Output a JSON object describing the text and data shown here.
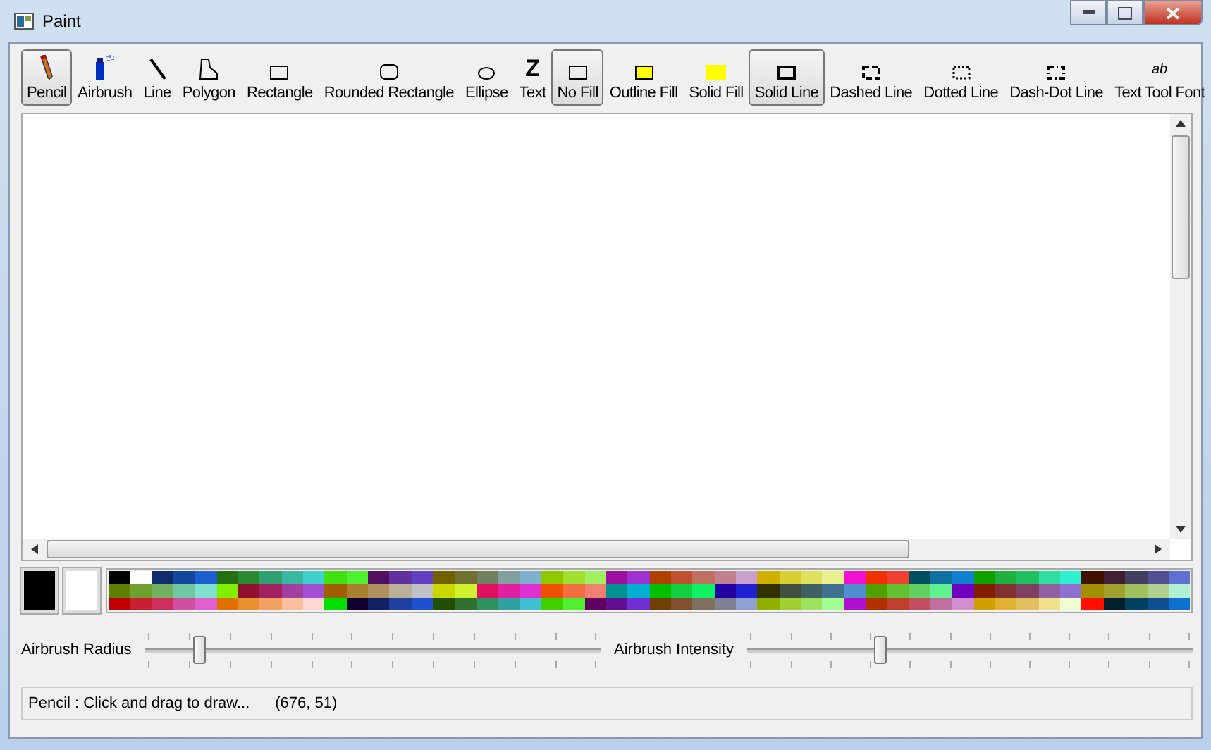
{
  "window": {
    "title": "Paint"
  },
  "tools": [
    {
      "kind": "pencil",
      "label": "Pencil",
      "selected": true
    },
    {
      "kind": "airbrush",
      "label": "Airbrush",
      "selected": false
    },
    {
      "kind": "line",
      "label": "Line",
      "selected": false
    },
    {
      "kind": "polygon",
      "label": "Polygon",
      "selected": false
    },
    {
      "kind": "rectangle",
      "label": "Rectangle",
      "selected": false
    },
    {
      "kind": "rounded",
      "label": "Rounded Rectangle",
      "selected": false
    },
    {
      "kind": "ellipse",
      "label": "Ellipse",
      "selected": false
    },
    {
      "kind": "text",
      "label": "Text",
      "selected": false,
      "glyph": "Z"
    }
  ],
  "fills": [
    {
      "kind": "none",
      "label": "No Fill",
      "selected": true
    },
    {
      "kind": "outline",
      "label": "Outline Fill",
      "selected": false
    },
    {
      "kind": "solid",
      "label": "Solid Fill",
      "selected": false
    }
  ],
  "line_styles": [
    {
      "kind": "solid",
      "label": "Solid Line",
      "selected": true
    },
    {
      "kind": "dashed",
      "label": "Dashed Line",
      "selected": false
    },
    {
      "kind": "dotted",
      "label": "Dotted Line",
      "selected": false
    },
    {
      "kind": "dashdot",
      "label": "Dash-Dot Line",
      "selected": false
    }
  ],
  "font_button": {
    "label": "Text Tool Font",
    "glyph": "ab"
  },
  "current_colors": [
    {
      "color": "#000000"
    },
    {
      "color": "#ffffff"
    }
  ],
  "palette_rows": [
    {
      "swatches": [
        {
          "color": "#000000"
        },
        {
          "color": "#ffffff"
        },
        {
          "color": "#0f2d6a"
        },
        {
          "color": "#1448a0"
        },
        {
          "color": "#1e5fd0"
        },
        {
          "color": "#237010"
        },
        {
          "color": "#2a8a30"
        },
        {
          "color": "#30a070"
        },
        {
          "color": "#38b8a0"
        },
        {
          "color": "#40d0d0"
        },
        {
          "color": "#40e010"
        },
        {
          "color": "#50f030"
        },
        {
          "color": "#501060"
        },
        {
          "color": "#6030a0"
        },
        {
          "color": "#6040c0"
        },
        {
          "color": "#706000"
        },
        {
          "color": "#707030"
        },
        {
          "color": "#708060"
        },
        {
          "color": "#80a0a0"
        },
        {
          "color": "#80b0d0"
        },
        {
          "color": "#90c800"
        },
        {
          "color": "#a0e030"
        },
        {
          "color": "#a0f060"
        },
        {
          "color": "#a010a0"
        },
        {
          "color": "#a030d0"
        },
        {
          "color": "#b04000"
        },
        {
          "color": "#c05030"
        },
        {
          "color": "#c07060"
        },
        {
          "color": "#c08090"
        },
        {
          "color": "#c8a0d0"
        },
        {
          "color": "#d0b000"
        },
        {
          "color": "#d8d030"
        },
        {
          "color": "#e0e060"
        },
        {
          "color": "#e8f090"
        },
        {
          "color": "#f010d0"
        },
        {
          "color": "#f03000"
        },
        {
          "color": "#f04030"
        },
        {
          "color": "#005060"
        },
        {
          "color": "#1070a0"
        },
        {
          "color": "#1080d0"
        },
        {
          "color": "#10a000"
        },
        {
          "color": "#20b040"
        },
        {
          "color": "#20c060"
        },
        {
          "color": "#30e0a0"
        },
        {
          "color": "#30f0d0"
        },
        {
          "color": "#401000"
        },
        {
          "color": "#402030"
        },
        {
          "color": "#404060"
        },
        {
          "color": "#505090"
        },
        {
          "color": "#6070d0"
        }
      ]
    },
    {
      "swatches": [
        {
          "color": "#608000"
        },
        {
          "color": "#70a030"
        },
        {
          "color": "#70b060"
        },
        {
          "color": "#70c8a0"
        },
        {
          "color": "#80e0d0"
        },
        {
          "color": "#80f000"
        },
        {
          "color": "#901030"
        },
        {
          "color": "#a02060"
        },
        {
          "color": "#a040a0"
        },
        {
          "color": "#a050d0"
        },
        {
          "color": "#a06000"
        },
        {
          "color": "#a88030"
        },
        {
          "color": "#b09060"
        },
        {
          "color": "#b8b098"
        },
        {
          "color": "#c0c0c8"
        },
        {
          "color": "#c8d800"
        },
        {
          "color": "#d0f030"
        },
        {
          "color": "#e01060"
        },
        {
          "color": "#e020a0"
        },
        {
          "color": "#e030d0"
        },
        {
          "color": "#f05000"
        },
        {
          "color": "#f07040"
        },
        {
          "color": "#f08070"
        },
        {
          "color": "#009090"
        },
        {
          "color": "#00b0d0"
        },
        {
          "color": "#00c000"
        },
        {
          "color": "#10d040"
        },
        {
          "color": "#10f060"
        },
        {
          "color": "#2000a0"
        },
        {
          "color": "#2020d0"
        },
        {
          "color": "#303000"
        },
        {
          "color": "#405040"
        },
        {
          "color": "#406060"
        },
        {
          "color": "#407090"
        },
        {
          "color": "#5090d0"
        },
        {
          "color": "#50a000"
        },
        {
          "color": "#60c030"
        },
        {
          "color": "#60d060"
        },
        {
          "color": "#60f090"
        },
        {
          "color": "#7000c0"
        },
        {
          "color": "#802000"
        },
        {
          "color": "#803030"
        },
        {
          "color": "#804060"
        },
        {
          "color": "#9060a0"
        },
        {
          "color": "#9070d0"
        },
        {
          "color": "#a09000"
        },
        {
          "color": "#a0a030"
        },
        {
          "color": "#a0c060"
        },
        {
          "color": "#b0d090"
        },
        {
          "color": "#b0f0d0"
        }
      ]
    },
    {
      "swatches": [
        {
          "color": "#c00000"
        },
        {
          "color": "#c82030"
        },
        {
          "color": "#d03060"
        },
        {
          "color": "#d050a0"
        },
        {
          "color": "#e060d0"
        },
        {
          "color": "#e07000"
        },
        {
          "color": "#e89030"
        },
        {
          "color": "#f0a060"
        },
        {
          "color": "#f8c0a0"
        },
        {
          "color": "#ffd8d0"
        },
        {
          "color": "#00e000"
        },
        {
          "color": "#100030"
        },
        {
          "color": "#102060"
        },
        {
          "color": "#2040a0"
        },
        {
          "color": "#2050d0"
        },
        {
          "color": "#205000"
        },
        {
          "color": "#307030"
        },
        {
          "color": "#309060"
        },
        {
          "color": "#30a0a0"
        },
        {
          "color": "#40c0d0"
        },
        {
          "color": "#40d000"
        },
        {
          "color": "#50f030"
        },
        {
          "color": "#600060"
        },
        {
          "color": "#601090"
        },
        {
          "color": "#7030d0"
        },
        {
          "color": "#704000"
        },
        {
          "color": "#805030"
        },
        {
          "color": "#807060"
        },
        {
          "color": "#808090"
        },
        {
          "color": "#90a0d0"
        },
        {
          "color": "#90b000"
        },
        {
          "color": "#a0d030"
        },
        {
          "color": "#a0e060"
        },
        {
          "color": "#a0ff90"
        },
        {
          "color": "#b010d0"
        },
        {
          "color": "#b03000"
        },
        {
          "color": "#c04030"
        },
        {
          "color": "#c05060"
        },
        {
          "color": "#c070a0"
        },
        {
          "color": "#d090d0"
        },
        {
          "color": "#d0a000"
        },
        {
          "color": "#e0b030"
        },
        {
          "color": "#e0c060"
        },
        {
          "color": "#f0e090"
        },
        {
          "color": "#f0ffd0"
        },
        {
          "color": "#ff1000"
        },
        {
          "color": "#002030"
        },
        {
          "color": "#004060"
        },
        {
          "color": "#105090"
        },
        {
          "color": "#1070d0"
        }
      ]
    }
  ],
  "sliders": [
    {
      "label": "Airbrush Radius",
      "level": 0.12
    },
    {
      "label": "Airbrush Intensity",
      "level": 0.3
    }
  ],
  "status_bar": {
    "message": "Pencil : Click and drag to draw...",
    "coords": "(676, 51)"
  }
}
